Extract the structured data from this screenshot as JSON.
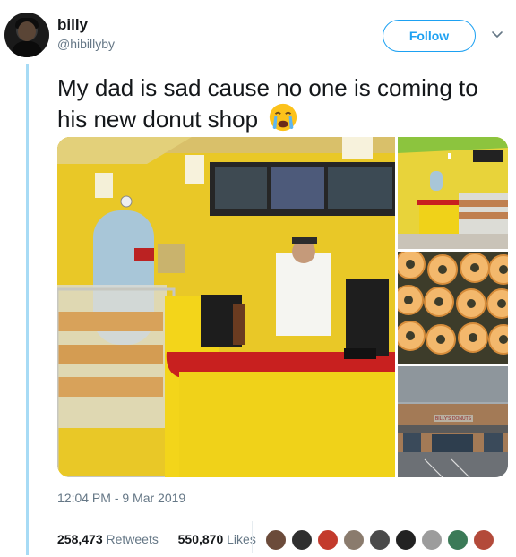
{
  "user": {
    "display_name": "billy",
    "handle": "@hibillyby"
  },
  "follow_button": {
    "label": "Follow"
  },
  "tweet": {
    "text": "My dad is sad cause no one is coming to his new donut shop",
    "emoji": "loudly-crying-face",
    "store_sign": "BILLY'S DONUTS",
    "timestamp": "12:04 PM - 9 Mar 2019"
  },
  "stats": {
    "retweets_count": "258,473",
    "retweets_label": "Retweets",
    "likes_count": "550,870",
    "likes_label": "Likes"
  },
  "likers": [
    {
      "color": "#6b4b3a"
    },
    {
      "color": "#2f2f2f"
    },
    {
      "color": "#c33a2c"
    },
    {
      "color": "#8a7b6d"
    },
    {
      "color": "#4a4a4a"
    },
    {
      "color": "#222222"
    },
    {
      "color": "#9c9c9c"
    },
    {
      "color": "#3b7a57"
    },
    {
      "color": "#b34a3a"
    }
  ],
  "colors": {
    "accent": "#1da1f2",
    "thread_line": "#a7dbf5",
    "shop_yellow": "#f2d21a",
    "counter_red": "#c8201f"
  }
}
